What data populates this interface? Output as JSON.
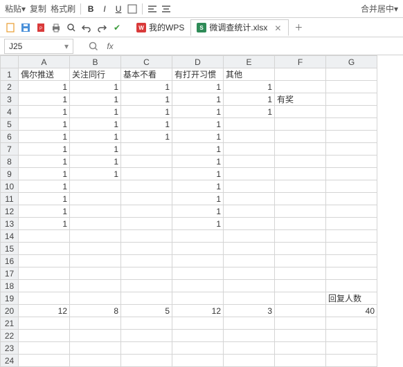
{
  "toolbar": {
    "paste_label": "粘贴",
    "copy_label": "复制",
    "format_painter_label": "格式刷",
    "merge_label": "合并居中"
  },
  "qat": {},
  "tabs": [
    {
      "icon": "wps",
      "label": "我的WPS",
      "active": false
    },
    {
      "icon": "xls",
      "label": "微调查统计.xlsx",
      "active": true
    }
  ],
  "namebox": {
    "value": "J25"
  },
  "formula": {
    "value": ""
  },
  "grid": {
    "columns": [
      "A",
      "B",
      "C",
      "D",
      "E",
      "F",
      "G"
    ],
    "row_count": 24,
    "rows": [
      {
        "r": 1,
        "cells": {
          "A": "偶尔推送",
          "B": "关注同行",
          "C": "基本不看",
          "D": "有打开习惯",
          "E": "其他"
        },
        "align": "l"
      },
      {
        "r": 2,
        "cells": {
          "A": "1",
          "B": "1",
          "C": "1",
          "D": "1",
          "E": "1"
        }
      },
      {
        "r": 3,
        "cells": {
          "A": "1",
          "B": "1",
          "C": "1",
          "D": "1",
          "E": "1",
          "F": "有奖"
        },
        "falign": "l"
      },
      {
        "r": 4,
        "cells": {
          "A": "1",
          "B": "1",
          "C": "1",
          "D": "1",
          "E": "1"
        }
      },
      {
        "r": 5,
        "cells": {
          "A": "1",
          "B": "1",
          "C": "1",
          "D": "1"
        }
      },
      {
        "r": 6,
        "cells": {
          "A": "1",
          "B": "1",
          "C": "1",
          "D": "1"
        }
      },
      {
        "r": 7,
        "cells": {
          "A": "1",
          "B": "1",
          "D": "1"
        }
      },
      {
        "r": 8,
        "cells": {
          "A": "1",
          "B": "1",
          "D": "1"
        }
      },
      {
        "r": 9,
        "cells": {
          "A": "1",
          "B": "1",
          "D": "1"
        }
      },
      {
        "r": 10,
        "cells": {
          "A": "1",
          "D": "1"
        }
      },
      {
        "r": 11,
        "cells": {
          "A": "1",
          "D": "1"
        }
      },
      {
        "r": 12,
        "cells": {
          "A": "1",
          "D": "1"
        }
      },
      {
        "r": 13,
        "cells": {
          "A": "1",
          "D": "1"
        }
      },
      {
        "r": 19,
        "cells": {
          "G": "回复人数"
        },
        "galign": "l"
      },
      {
        "r": 20,
        "cells": {
          "A": "12",
          "B": "8",
          "C": "5",
          "D": "12",
          "E": "3",
          "G": "40"
        }
      }
    ]
  }
}
